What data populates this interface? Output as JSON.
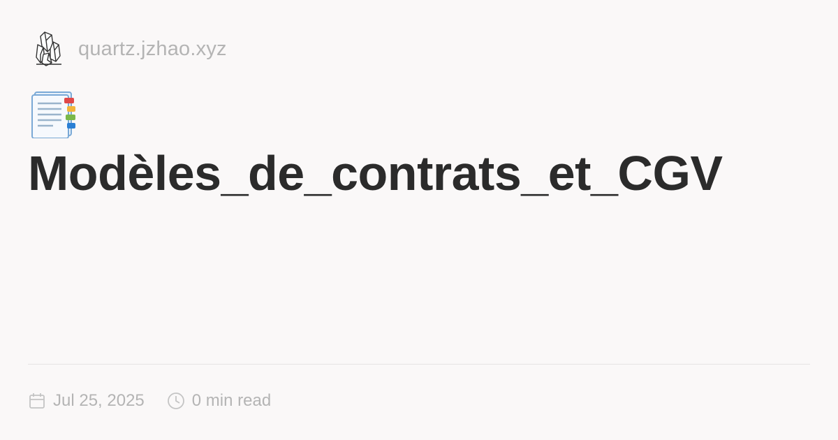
{
  "site": {
    "url": "quartz.jzhao.xyz",
    "logo_icon": "crystal-icon"
  },
  "page": {
    "emoji_icon": "bookmark-tabs-icon",
    "title": "Modèles_de_contrats_et_CGV"
  },
  "meta": {
    "date": "Jul 25, 2025",
    "date_icon": "calendar-icon",
    "read_time": "0 min read",
    "read_time_icon": "clock-icon"
  },
  "colors": {
    "background": "#faf8f8",
    "title": "#2b2b2b",
    "muted": "#b4b4b4",
    "divider": "#e6e4e4"
  }
}
